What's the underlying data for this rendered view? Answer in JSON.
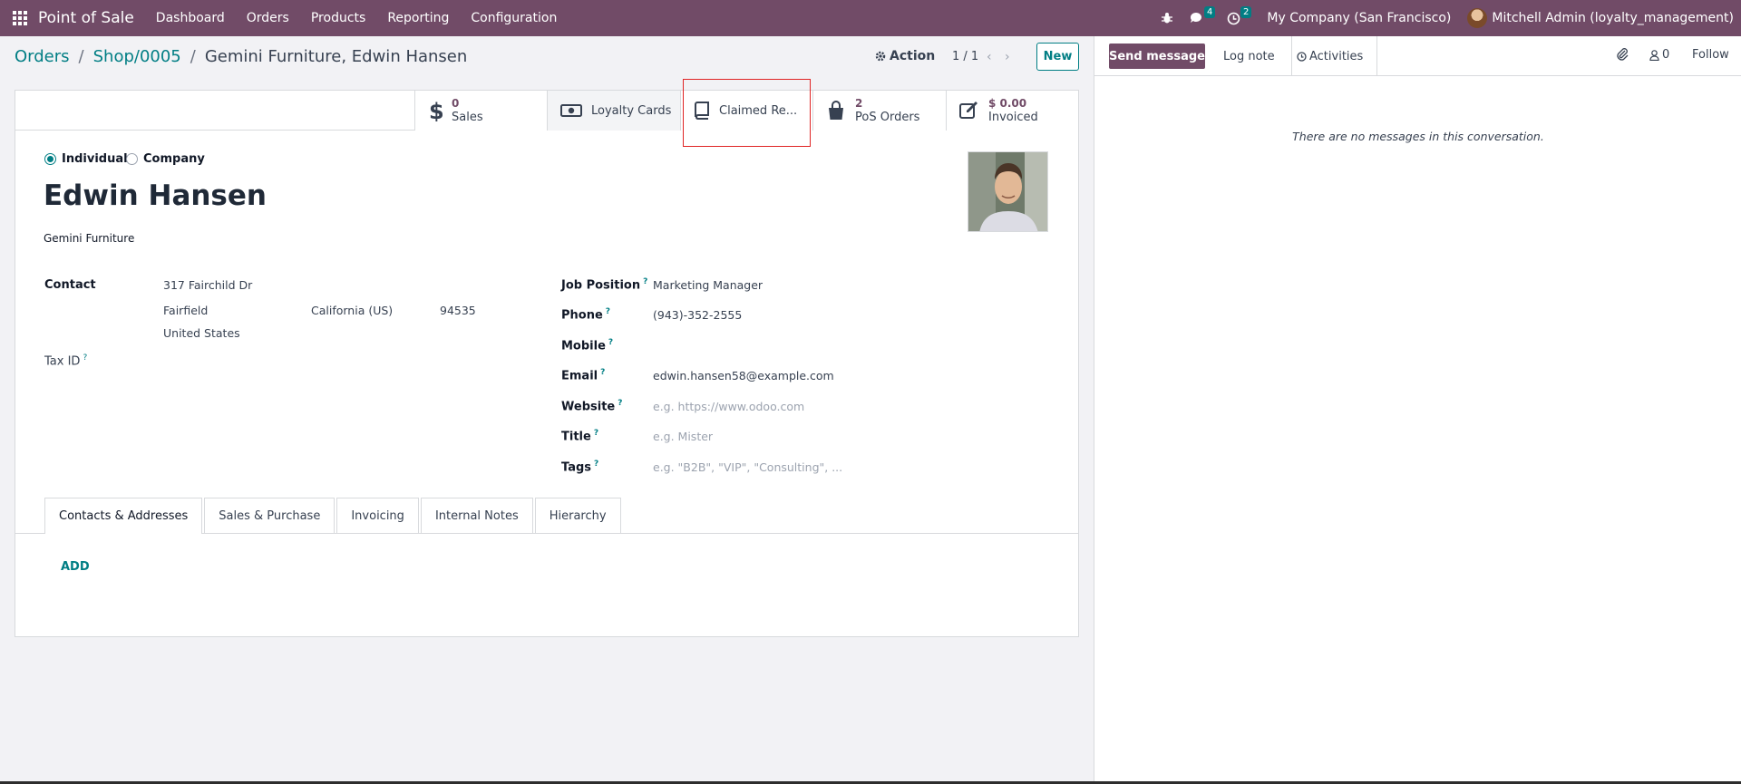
{
  "navbar": {
    "brand": "Point of Sale",
    "menu": [
      "Dashboard",
      "Orders",
      "Products",
      "Reporting",
      "Configuration"
    ],
    "messages_count": "4",
    "activities_count": "2",
    "company": "My Company (San Francisco)",
    "user": "Mitchell Admin (loyalty_management)"
  },
  "breadcrumb": {
    "items": [
      "Orders",
      "Shop/0005"
    ],
    "current": "Gemini Furniture, Edwin Hansen"
  },
  "control": {
    "action_label": "Action",
    "pager": "1 / 1",
    "new_label": "New"
  },
  "smart_buttons": {
    "sales": {
      "value": "0",
      "label": "Sales"
    },
    "loyalty": {
      "label": "Loyalty Cards"
    },
    "claimed": {
      "label": "Claimed Re..."
    },
    "pos_orders": {
      "value": "2",
      "label": "PoS Orders"
    },
    "invoiced": {
      "value": "$ 0.00",
      "label": "Invoiced"
    }
  },
  "partner": {
    "type_individual": "Individual",
    "type_company": "Company",
    "selected_type": "Individual",
    "name": "Edwin Hansen",
    "company_name": "Gemini Furniture",
    "contact_label": "Contact",
    "street": "317 Fairchild Dr",
    "city": "Fairfield",
    "state": "California (US)",
    "zip": "94535",
    "country": "United States",
    "tax_id_label": "Tax ID",
    "job_position_label": "Job Position",
    "job_position": "Marketing Manager",
    "phone_label": "Phone",
    "phone": "(943)-352-2555",
    "mobile_label": "Mobile",
    "email_label": "Email",
    "email": "edwin.hansen58@example.com",
    "website_label": "Website",
    "website_placeholder": "e.g. https://www.odoo.com",
    "title_label": "Title",
    "title_placeholder": "e.g. Mister",
    "tags_label": "Tags",
    "tags_placeholder": "e.g. \"B2B\", \"VIP\", \"Consulting\", ..."
  },
  "tabs": [
    "Contacts & Addresses",
    "Sales & Purchase",
    "Invoicing",
    "Internal Notes",
    "Hierarchy"
  ],
  "add_label": "ADD",
  "chatter": {
    "send_message": "Send message",
    "log_note": "Log note",
    "activities": "Activities",
    "followers_count": "0",
    "follow": "Follow",
    "empty": "There are no messages in this conversation."
  },
  "colors": {
    "brand": "#714b67",
    "accent": "#017e84",
    "highlight": "#e02424"
  }
}
